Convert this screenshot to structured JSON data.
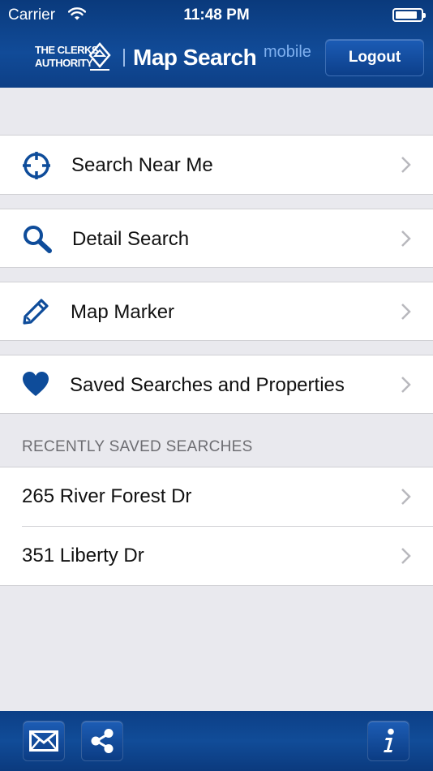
{
  "status": {
    "carrier": "Carrier",
    "time": "11:48 PM"
  },
  "header": {
    "logo_line1": "THE CLERKS",
    "logo_line2": "AUTHORITY",
    "title": "Map Search",
    "title_suffix": "mobile",
    "logout_label": "Logout"
  },
  "menu": [
    {
      "label": "Search Near Me",
      "icon": "crosshair-icon"
    },
    {
      "label": "Detail Search",
      "icon": "search-icon"
    },
    {
      "label": "Map Marker",
      "icon": "pencil-icon"
    },
    {
      "label": "Saved Searches and Properties",
      "icon": "heart-icon"
    }
  ],
  "recent": {
    "header": "RECENTLY SAVED SEARCHES",
    "items": [
      {
        "label": "265 River Forest Dr"
      },
      {
        "label": "351 Liberty Dr"
      }
    ]
  },
  "toolbar": {
    "icons": [
      "mail-icon",
      "share-icon",
      "info-icon"
    ]
  },
  "colors": {
    "brand": "#114b98",
    "icon": "#0e4c9a",
    "background": "#e9e9ee"
  }
}
